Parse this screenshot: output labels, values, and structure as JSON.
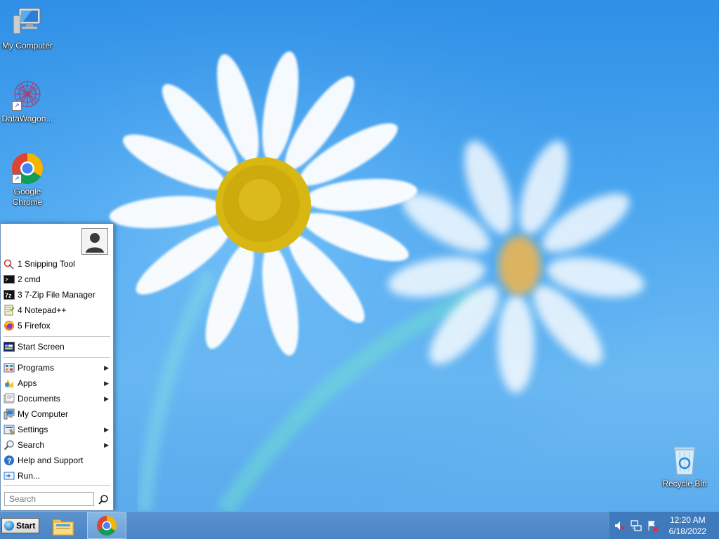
{
  "desktop_icons": [
    {
      "name": "My Computer",
      "icon": "computer-icon"
    },
    {
      "name": "DataWagon...",
      "icon": "datawagon-icon"
    },
    {
      "name": "Google\nChrome",
      "icon": "chrome-icon"
    },
    {
      "name": "Recycle Bin",
      "icon": "recycle-bin-icon"
    }
  ],
  "start_menu": {
    "recent": [
      {
        "label": "1 Snipping Tool",
        "icon": "snipping-tool-icon"
      },
      {
        "label": "2 cmd",
        "icon": "cmd-icon"
      },
      {
        "label": "3 7-Zip File Manager",
        "icon": "7zip-icon"
      },
      {
        "label": "4 Notepad++",
        "icon": "notepadpp-icon"
      },
      {
        "label": "5 Firefox",
        "icon": "firefox-icon"
      }
    ],
    "start_screen": "Start Screen",
    "items": [
      {
        "label": "Programs",
        "icon": "programs-icon",
        "submenu": true
      },
      {
        "label": "Apps",
        "icon": "apps-icon",
        "submenu": true
      },
      {
        "label": "Documents",
        "icon": "documents-icon",
        "submenu": true
      },
      {
        "label": "My Computer",
        "icon": "computer-icon",
        "submenu": false
      },
      {
        "label": "Settings",
        "icon": "settings-icon",
        "submenu": true
      },
      {
        "label": "Search",
        "icon": "search-icon",
        "submenu": true
      },
      {
        "label": "Help and Support",
        "icon": "help-icon",
        "submenu": false
      },
      {
        "label": "Run...",
        "icon": "run-icon",
        "submenu": false
      }
    ],
    "search_placeholder": "Search"
  },
  "taskbar": {
    "start_label": "Start",
    "pinned": [
      "file-explorer-icon",
      "chrome-icon"
    ],
    "tray_icons": [
      "volume-muted-icon",
      "network-icon",
      "action-center-icon"
    ],
    "clock_time": "12:20 AM",
    "clock_date": "6/18/2022"
  },
  "colors": {
    "wallpaper_blue": "#3b9ae8",
    "taskbar": "#4a84c4",
    "tray": "#3f7abd"
  }
}
